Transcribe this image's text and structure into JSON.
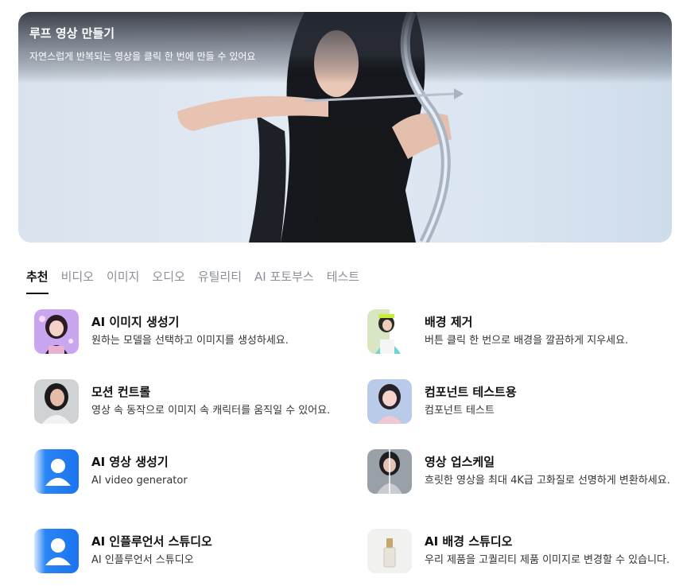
{
  "hero": {
    "title": "루프 영상 만들기",
    "subtitle": "자연스럽게 반복되는 영상을 클릭 한 번에 만들 수 있어요"
  },
  "tabs": [
    {
      "label": "추천",
      "active": true
    },
    {
      "label": "비디오"
    },
    {
      "label": "이미지"
    },
    {
      "label": "오디오"
    },
    {
      "label": "유틸리티"
    },
    {
      "label": "AI 포토부스"
    },
    {
      "label": "테스트"
    }
  ],
  "tools": [
    {
      "title": "AI 이미지 생성기",
      "desc": "원하는 모델을 선택하고 이미지를 생성하세요.",
      "icon": "ai-image-generator-thumbnail"
    },
    {
      "title": "배경 제거",
      "desc": "버튼 클릭 한 번으로 배경을 깔끔하게 지우세요.",
      "icon": "background-remover-thumbnail"
    },
    {
      "title": "모션 컨트롤",
      "desc": "영상 속 동작으로 이미지 속 캐릭터를 움직일 수 있어요.",
      "icon": "motion-control-thumbnail"
    },
    {
      "title": "컴포넌트 테스트용",
      "desc": "컴포넌트 테스트",
      "icon": "component-test-thumbnail"
    },
    {
      "title": "AI 영상 생성기",
      "desc": "AI video generator",
      "icon": "user-placeholder-icon"
    },
    {
      "title": "영상 업스케일",
      "desc": "흐릿한 영상을 최대 4K급 고화질로 선명하게 변환하세요.",
      "icon": "video-upscale-thumbnail"
    },
    {
      "title": "AI 인플루언서 스튜디오",
      "desc": "AI 인플루언서 스튜디오",
      "icon": "user-placeholder-icon"
    },
    {
      "title": "AI 배경 스튜디오",
      "desc": "우리 제품을 고퀄리티 제품 이미지로 변경할 수 있습니다.",
      "icon": "product-bottle-thumbnail"
    }
  ],
  "colors": {
    "accent_blue": "#1f7bf2",
    "tab_inactive": "#8a8f98"
  }
}
